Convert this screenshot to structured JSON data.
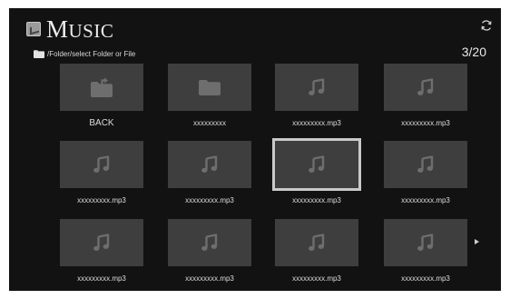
{
  "header": {
    "title_cap": "M",
    "title_rest": "USIC",
    "path": "/Folder/select Folder or File",
    "page_count": "3/20"
  },
  "icons": {
    "app": "music-app-icon",
    "refresh": "refresh-icon",
    "folder": "folder-icon",
    "back": "back-folder-icon",
    "music": "music-note-icon",
    "next": "next-page-arrow-icon"
  },
  "colors": {
    "background": "#121212",
    "tile": "#3e3e3e",
    "icon": "#6e6e6e",
    "selection_border": "#c9c9c9"
  },
  "grid": {
    "selected_index": 6,
    "items": [
      {
        "type": "back",
        "label": "BACK"
      },
      {
        "type": "folder",
        "label": "xxxxxxxxx"
      },
      {
        "type": "music",
        "label": "xxxxxxxxx.mp3"
      },
      {
        "type": "music",
        "label": "xxxxxxxxx.mp3"
      },
      {
        "type": "music",
        "label": "xxxxxxxxx.mp3"
      },
      {
        "type": "music",
        "label": "xxxxxxxxx.mp3"
      },
      {
        "type": "music",
        "label": "xxxxxxxxx.mp3"
      },
      {
        "type": "music",
        "label": "xxxxxxxxx.mp3"
      },
      {
        "type": "music",
        "label": "xxxxxxxxx.mp3"
      },
      {
        "type": "music",
        "label": "xxxxxxxxx.mp3"
      },
      {
        "type": "music",
        "label": "xxxxxxxxx.mp3"
      },
      {
        "type": "music",
        "label": "xxxxxxxxx.mp3"
      }
    ]
  }
}
